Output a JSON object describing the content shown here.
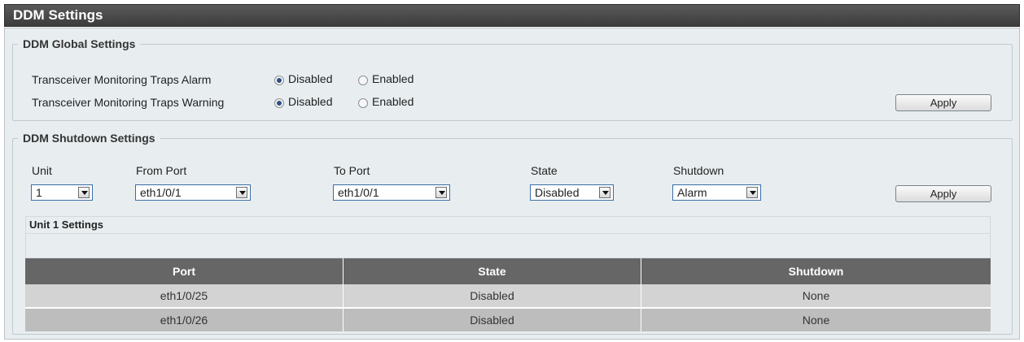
{
  "page": {
    "title": "DDM Settings"
  },
  "global": {
    "legend": "DDM Global Settings",
    "rows": [
      {
        "label": "Transceiver Monitoring Traps Alarm",
        "selected": "Disabled",
        "options": [
          "Disabled",
          "Enabled"
        ]
      },
      {
        "label": "Transceiver Monitoring Traps Warning",
        "selected": "Disabled",
        "options": [
          "Disabled",
          "Enabled"
        ]
      }
    ],
    "apply_label": "Apply"
  },
  "shutdown": {
    "legend": "DDM Shutdown Settings",
    "fields": {
      "unit": {
        "label": "Unit",
        "value": "1"
      },
      "from_port": {
        "label": "From Port",
        "value": "eth1/0/1"
      },
      "to_port": {
        "label": "To Port",
        "value": "eth1/0/1"
      },
      "state": {
        "label": "State",
        "value": "Disabled"
      },
      "shutdown": {
        "label": "Shutdown",
        "value": "Alarm"
      }
    },
    "apply_label": "Apply"
  },
  "unit_settings": {
    "title": "Unit 1 Settings",
    "columns": [
      "Port",
      "State",
      "Shutdown"
    ],
    "rows": [
      [
        "eth1/0/25",
        "Disabled",
        "None"
      ],
      [
        "eth1/0/26",
        "Disabled",
        "None"
      ]
    ]
  },
  "colors": {
    "title_bar": "#444444",
    "panel_bg": "#e8eef0",
    "table_header": "#666666",
    "row_light": "#d3d3d3",
    "row_dark": "#bdbdbd",
    "radio_dot": "#2e4f86"
  }
}
